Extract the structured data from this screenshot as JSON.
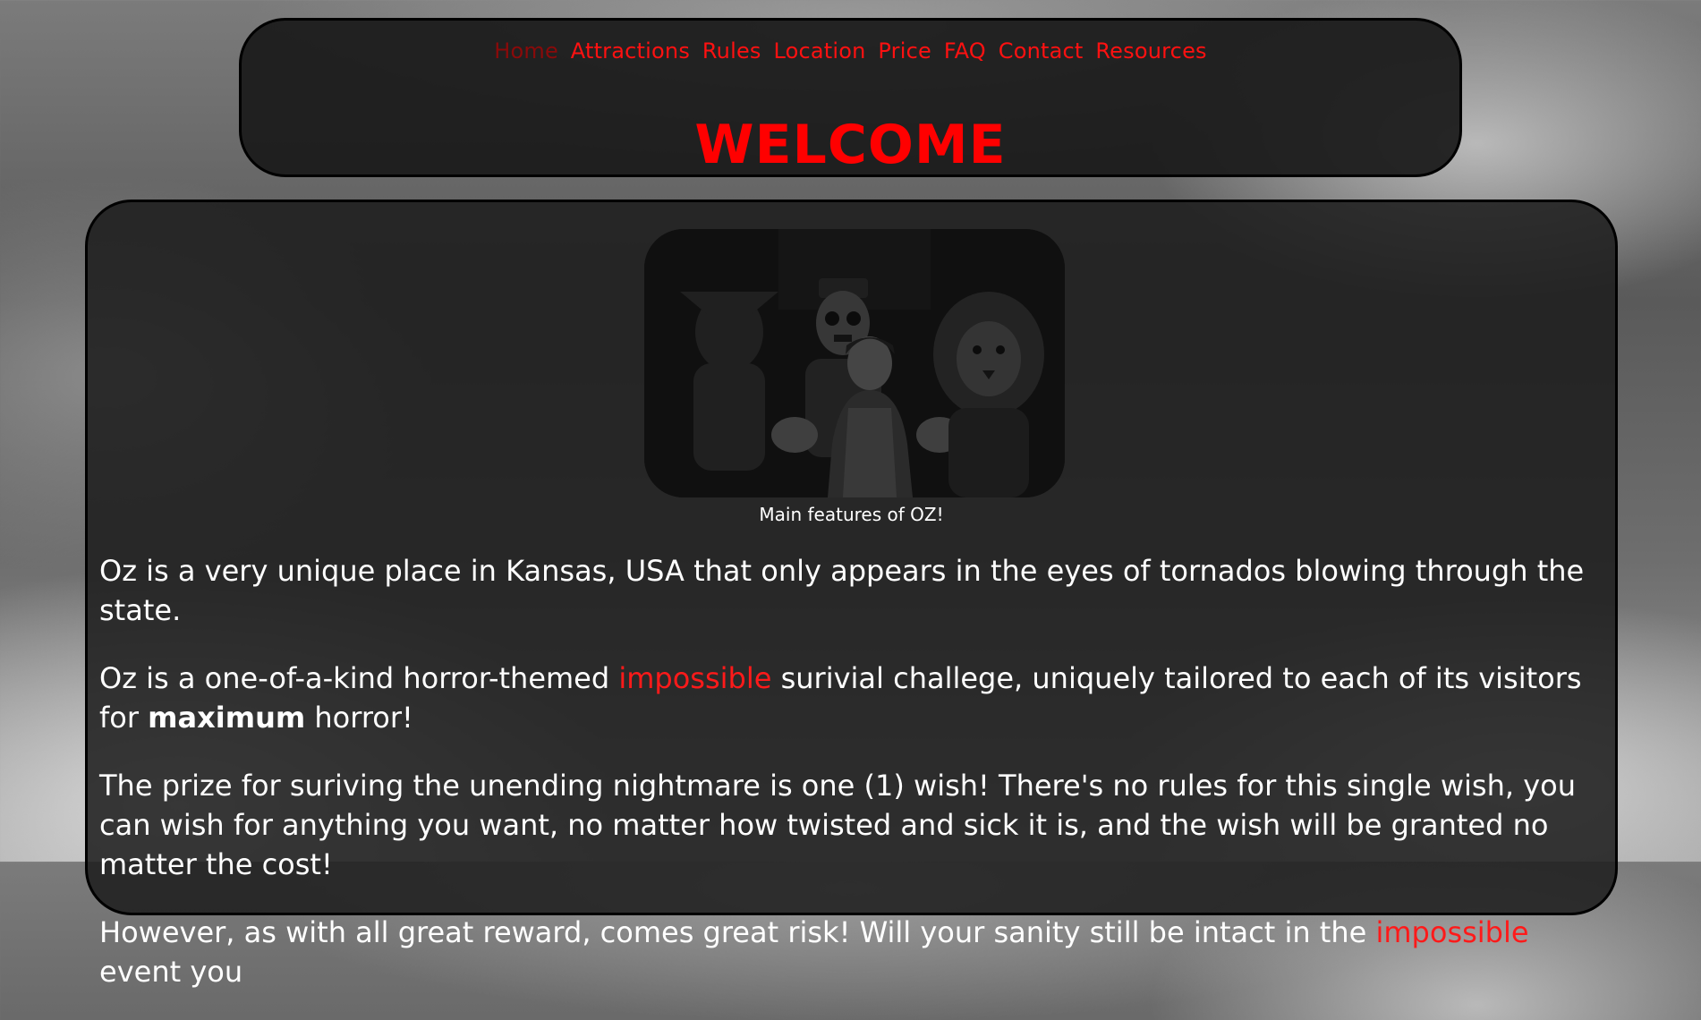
{
  "nav": {
    "items": [
      {
        "label": "Home",
        "current": true
      },
      {
        "label": "Attractions"
      },
      {
        "label": "Rules"
      },
      {
        "label": "Location"
      },
      {
        "label": "Price"
      },
      {
        "label": "FAQ"
      },
      {
        "label": "Contact"
      },
      {
        "label": "Resources"
      }
    ]
  },
  "header": {
    "title": "WELCOME"
  },
  "hero": {
    "image_icon": "oz-characters-photo",
    "caption": "Main features of OZ!"
  },
  "paragraphs": {
    "p1": "Oz is a very unique place in Kansas, USA that only appears in the eyes of tornados blowing through the state.",
    "p2_a": "Oz is a one-of-a-kind horror-themed ",
    "p2_highlight": "impossible",
    "p2_b": " surivial challege, uniquely tailored to each of its visitors for ",
    "p2_bold": "maximum",
    "p2_c": " horror!",
    "p3": "The prize for suriving the unending nightmare is one (1) wish! There's no rules for this single wish, you can wish for anything you want, no matter how twisted and sick it is, and the wish will be granted no matter the cost!",
    "p4_a": "However, as with all great reward, comes great risk! Will your sanity still be intact in the ",
    "p4_highlight": "impossible",
    "p4_b": " event you"
  },
  "colors": {
    "accent": "#ff0000",
    "nav_current": "#8a0a0a",
    "panel": "#1c1c1c",
    "text": "#ffffff"
  }
}
